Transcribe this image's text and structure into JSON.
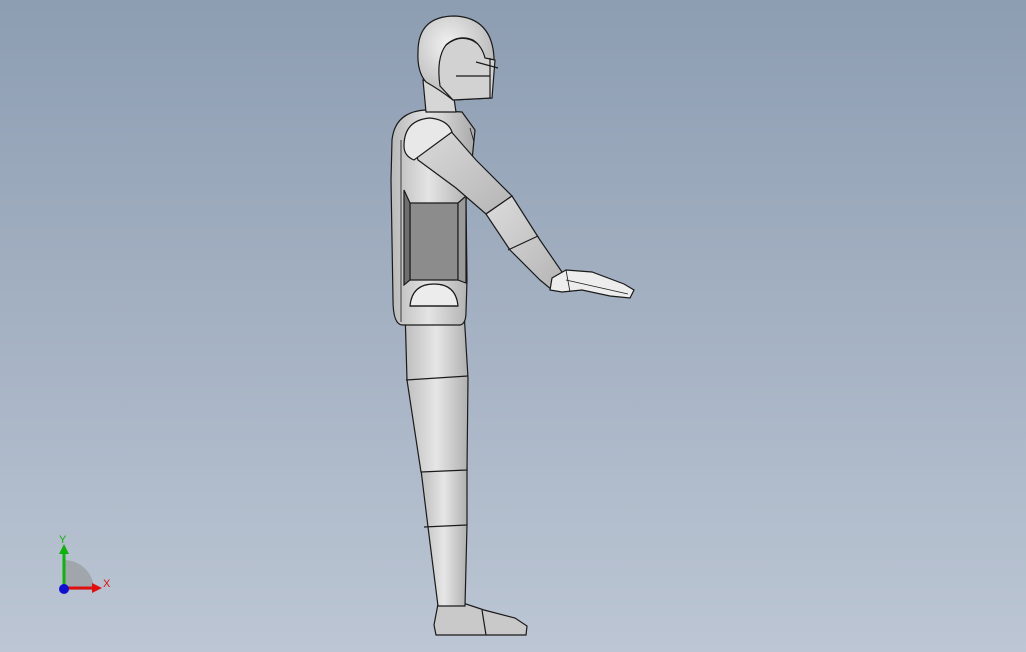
{
  "viewport": {
    "background_top": "#8d9db2",
    "background_bottom": "#bcc6d4"
  },
  "model": {
    "part_fill": "#cfcfcf",
    "part_shade": "#8a8a8a",
    "edge_color": "#1a1a1a"
  },
  "triad": {
    "x_label": "X",
    "y_label": "Y",
    "x_color": "#e01010",
    "y_color": "#10b010",
    "z_color": "#1010d0"
  }
}
